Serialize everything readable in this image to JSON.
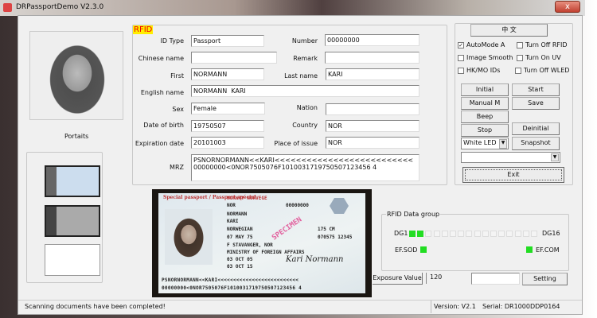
{
  "window": {
    "title": "DRPassportDemo V2.3.0",
    "close": "x"
  },
  "portrait": {
    "label": "Portaits"
  },
  "rfid": {
    "title": "RFID",
    "fields": {
      "id_type": {
        "label": "ID Type",
        "value": "Passport"
      },
      "number": {
        "label": "Number",
        "value": "00000000"
      },
      "chinese_name": {
        "label": "Chinese name",
        "value": ""
      },
      "remark": {
        "label": "Remark",
        "value": ""
      },
      "first": {
        "label": "First",
        "value": "NORMANN"
      },
      "last_name": {
        "label": "Last name",
        "value": "KARI"
      },
      "english_name": {
        "label": "English name",
        "value": "NORMANN  KARI"
      },
      "sex": {
        "label": "Sex",
        "value": "Female"
      },
      "nation": {
        "label": "Nation",
        "value": ""
      },
      "dob": {
        "label": "Date of birth",
        "value": "19750507"
      },
      "country": {
        "label": "Country",
        "value": "NOR"
      },
      "expiration": {
        "label": "Expiration date",
        "value": "20101003"
      },
      "place_of_issue": {
        "label": "Place of issue",
        "value": "NOR"
      },
      "mrz": {
        "label": "MRZ",
        "value": "PSNORNORMANN<<KARI<<<<<<<<<<<<<<<<<<<<<<<<<<\n00000000<0NOR7505076F1010031719750507123456 4"
      }
    }
  },
  "controls": {
    "lang_button": "中 文",
    "checks": [
      {
        "label": "AutoMode A",
        "checked": true
      },
      {
        "label": "Turn Off RFID",
        "checked": false
      },
      {
        "label": "Image Smooth",
        "checked": false
      },
      {
        "label": "Turn On UV",
        "checked": false
      },
      {
        "label": "HK/MO IDs",
        "checked": false
      },
      {
        "label": "Turn Off WLED",
        "checked": false
      }
    ],
    "buttons": {
      "initial": "Initial",
      "start": "Start",
      "manual": "Manual  M",
      "save": "Save",
      "beep": "Beep",
      "stop": "Stop",
      "deinitial": "Deinitial",
      "snapshot": "Snapshot",
      "exit": "Exit"
    },
    "led_select": "White LED",
    "combo": ""
  },
  "passport_image": {
    "header": "NORWAY  NORVEGE",
    "type": "Special passport / Passport spécial",
    "surname": "NORMANN",
    "given": "KARI",
    "nationality": "NORWEGIAN",
    "dob": "07 MAY 75",
    "sex_place": "F      STAVANGER, NOR",
    "authority": "MINISTRY OF FOREIGN AFFAIRS",
    "issue": "03 OCT 05",
    "expiry": "03 OCT 15",
    "height": "175 CM",
    "pnum": "070575 12345",
    "code": "NOR",
    "number": "00000000",
    "signature": "Kari Normann",
    "specimen": "SPECIMEN",
    "mrz1": "PSNORNORMANN<<KARI<<<<<<<<<<<<<<<<<<<<<<<<<<",
    "mrz2": "00000000<0NOR7505076F1010031719750507123456 4"
  },
  "data_group": {
    "title": "RFID Data group",
    "dg1": "DG1",
    "dg16": "DG16",
    "ef_sod": "EF.SOD",
    "ef_com": "EF.COM",
    "dg_status": [
      1,
      1,
      0,
      0,
      0,
      0,
      0,
      0,
      0,
      0,
      0,
      0,
      0,
      0,
      0,
      0
    ],
    "ef_sod_on": true,
    "ef_com_on": true,
    "green": "#22dd22"
  },
  "exposure": {
    "label": "Exposure Value",
    "value": "120",
    "setting_input": "",
    "setting": "Setting"
  },
  "status": {
    "message": "Scanning documents have been completed!",
    "version": "Version: V2.1",
    "serial": "Serial: DR1000DDP0164"
  }
}
